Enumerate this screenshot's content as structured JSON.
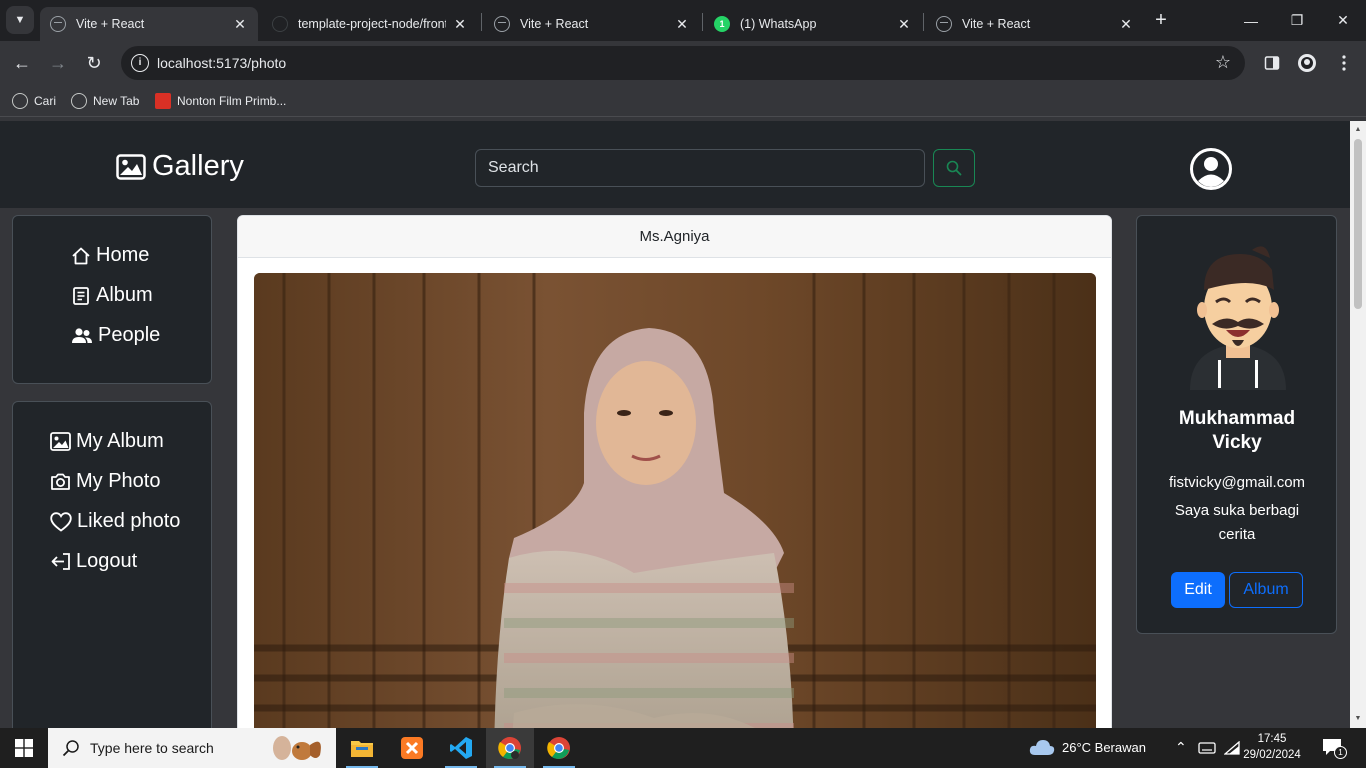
{
  "browser": {
    "tabs": [
      {
        "title": "Vite + React",
        "active": true,
        "favicon": "globe-icon"
      },
      {
        "title": "template-project-node/front",
        "active": false,
        "favicon": "github-icon"
      },
      {
        "title": "Vite + React",
        "active": false,
        "favicon": "globe-icon"
      },
      {
        "title": "(1) WhatsApp",
        "active": false,
        "favicon": "whatsapp-icon"
      },
      {
        "title": "Vite + React",
        "active": false,
        "favicon": "globe-icon"
      }
    ],
    "whatsapp_badge": "1",
    "url": "localhost:5173/photo",
    "bookmarks": [
      {
        "label": "Cari",
        "icon": "globe-icon"
      },
      {
        "label": "New Tab",
        "icon": "globe-icon"
      },
      {
        "label": "Nonton Film Primb...",
        "icon": "film-icon"
      }
    ]
  },
  "app": {
    "brand": "Gallery",
    "search": {
      "placeholder": "Search",
      "value": ""
    },
    "sidebar_main": [
      {
        "label": "Home",
        "icon": "home-icon"
      },
      {
        "label": "Album",
        "icon": "album-icon"
      },
      {
        "label": "People",
        "icon": "people-icon"
      }
    ],
    "sidebar_user": [
      {
        "label": "My Album",
        "icon": "image-icon"
      },
      {
        "label": "My Photo",
        "icon": "camera-icon"
      },
      {
        "label": "Liked photo",
        "icon": "heart-icon"
      },
      {
        "label": "Logout",
        "icon": "logout-icon"
      }
    ],
    "photo": {
      "owner": "Ms.Agniya"
    },
    "profile": {
      "name_line1": "Mukhammad",
      "name_line2": "Vicky",
      "email": "fistvicky@gmail.com",
      "bio_line1": "Saya suka berbagi",
      "bio_line2": "cerita",
      "edit_label": "Edit",
      "album_label": "Album"
    },
    "colors": {
      "navbar": "#212529",
      "primary": "#0d6efd",
      "success": "#198754"
    }
  },
  "taskbar": {
    "search_placeholder": "Type here to search",
    "weather": "26°C  Berawan",
    "time": "17:45",
    "date": "29/02/2024",
    "notification_count": "1"
  }
}
